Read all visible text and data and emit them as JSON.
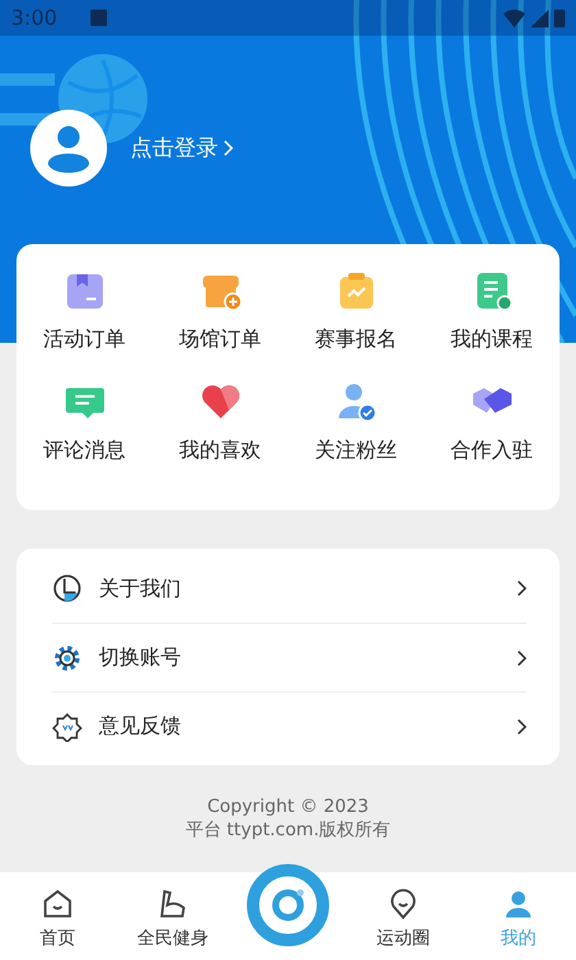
{
  "status_bar": {
    "time": "3:00"
  },
  "profile": {
    "login_label": "点击登录"
  },
  "shortcuts": [
    {
      "label": "活动订单",
      "kind": "box"
    },
    {
      "label": "场馆订单",
      "kind": "store"
    },
    {
      "label": "赛事报名",
      "kind": "clipboard"
    },
    {
      "label": "我的课程",
      "kind": "document"
    },
    {
      "label": "评论消息",
      "kind": "chat"
    },
    {
      "label": "我的喜欢",
      "kind": "heart"
    },
    {
      "label": "关注粉丝",
      "kind": "user"
    },
    {
      "label": "合作入驻",
      "kind": "handshake"
    }
  ],
  "menu": [
    {
      "label": "关于我们",
      "kind": "info"
    },
    {
      "label": "切换账号",
      "kind": "gear"
    },
    {
      "label": "意见反馈",
      "kind": "badge"
    }
  ],
  "footer": {
    "copyright": "Copyright © 2023",
    "site": "平台 ttypt.com.版权所有"
  },
  "tab_bar": [
    {
      "label": "首页",
      "kind": "home",
      "selected": false
    },
    {
      "label": "全民健身",
      "kind": "arm",
      "selected": false
    },
    {
      "kind": "camera",
      "selected": false
    },
    {
      "label": "运动圈",
      "kind": "pin",
      "selected": false
    },
    {
      "label": "我的",
      "kind": "person",
      "selected": true
    }
  ]
}
